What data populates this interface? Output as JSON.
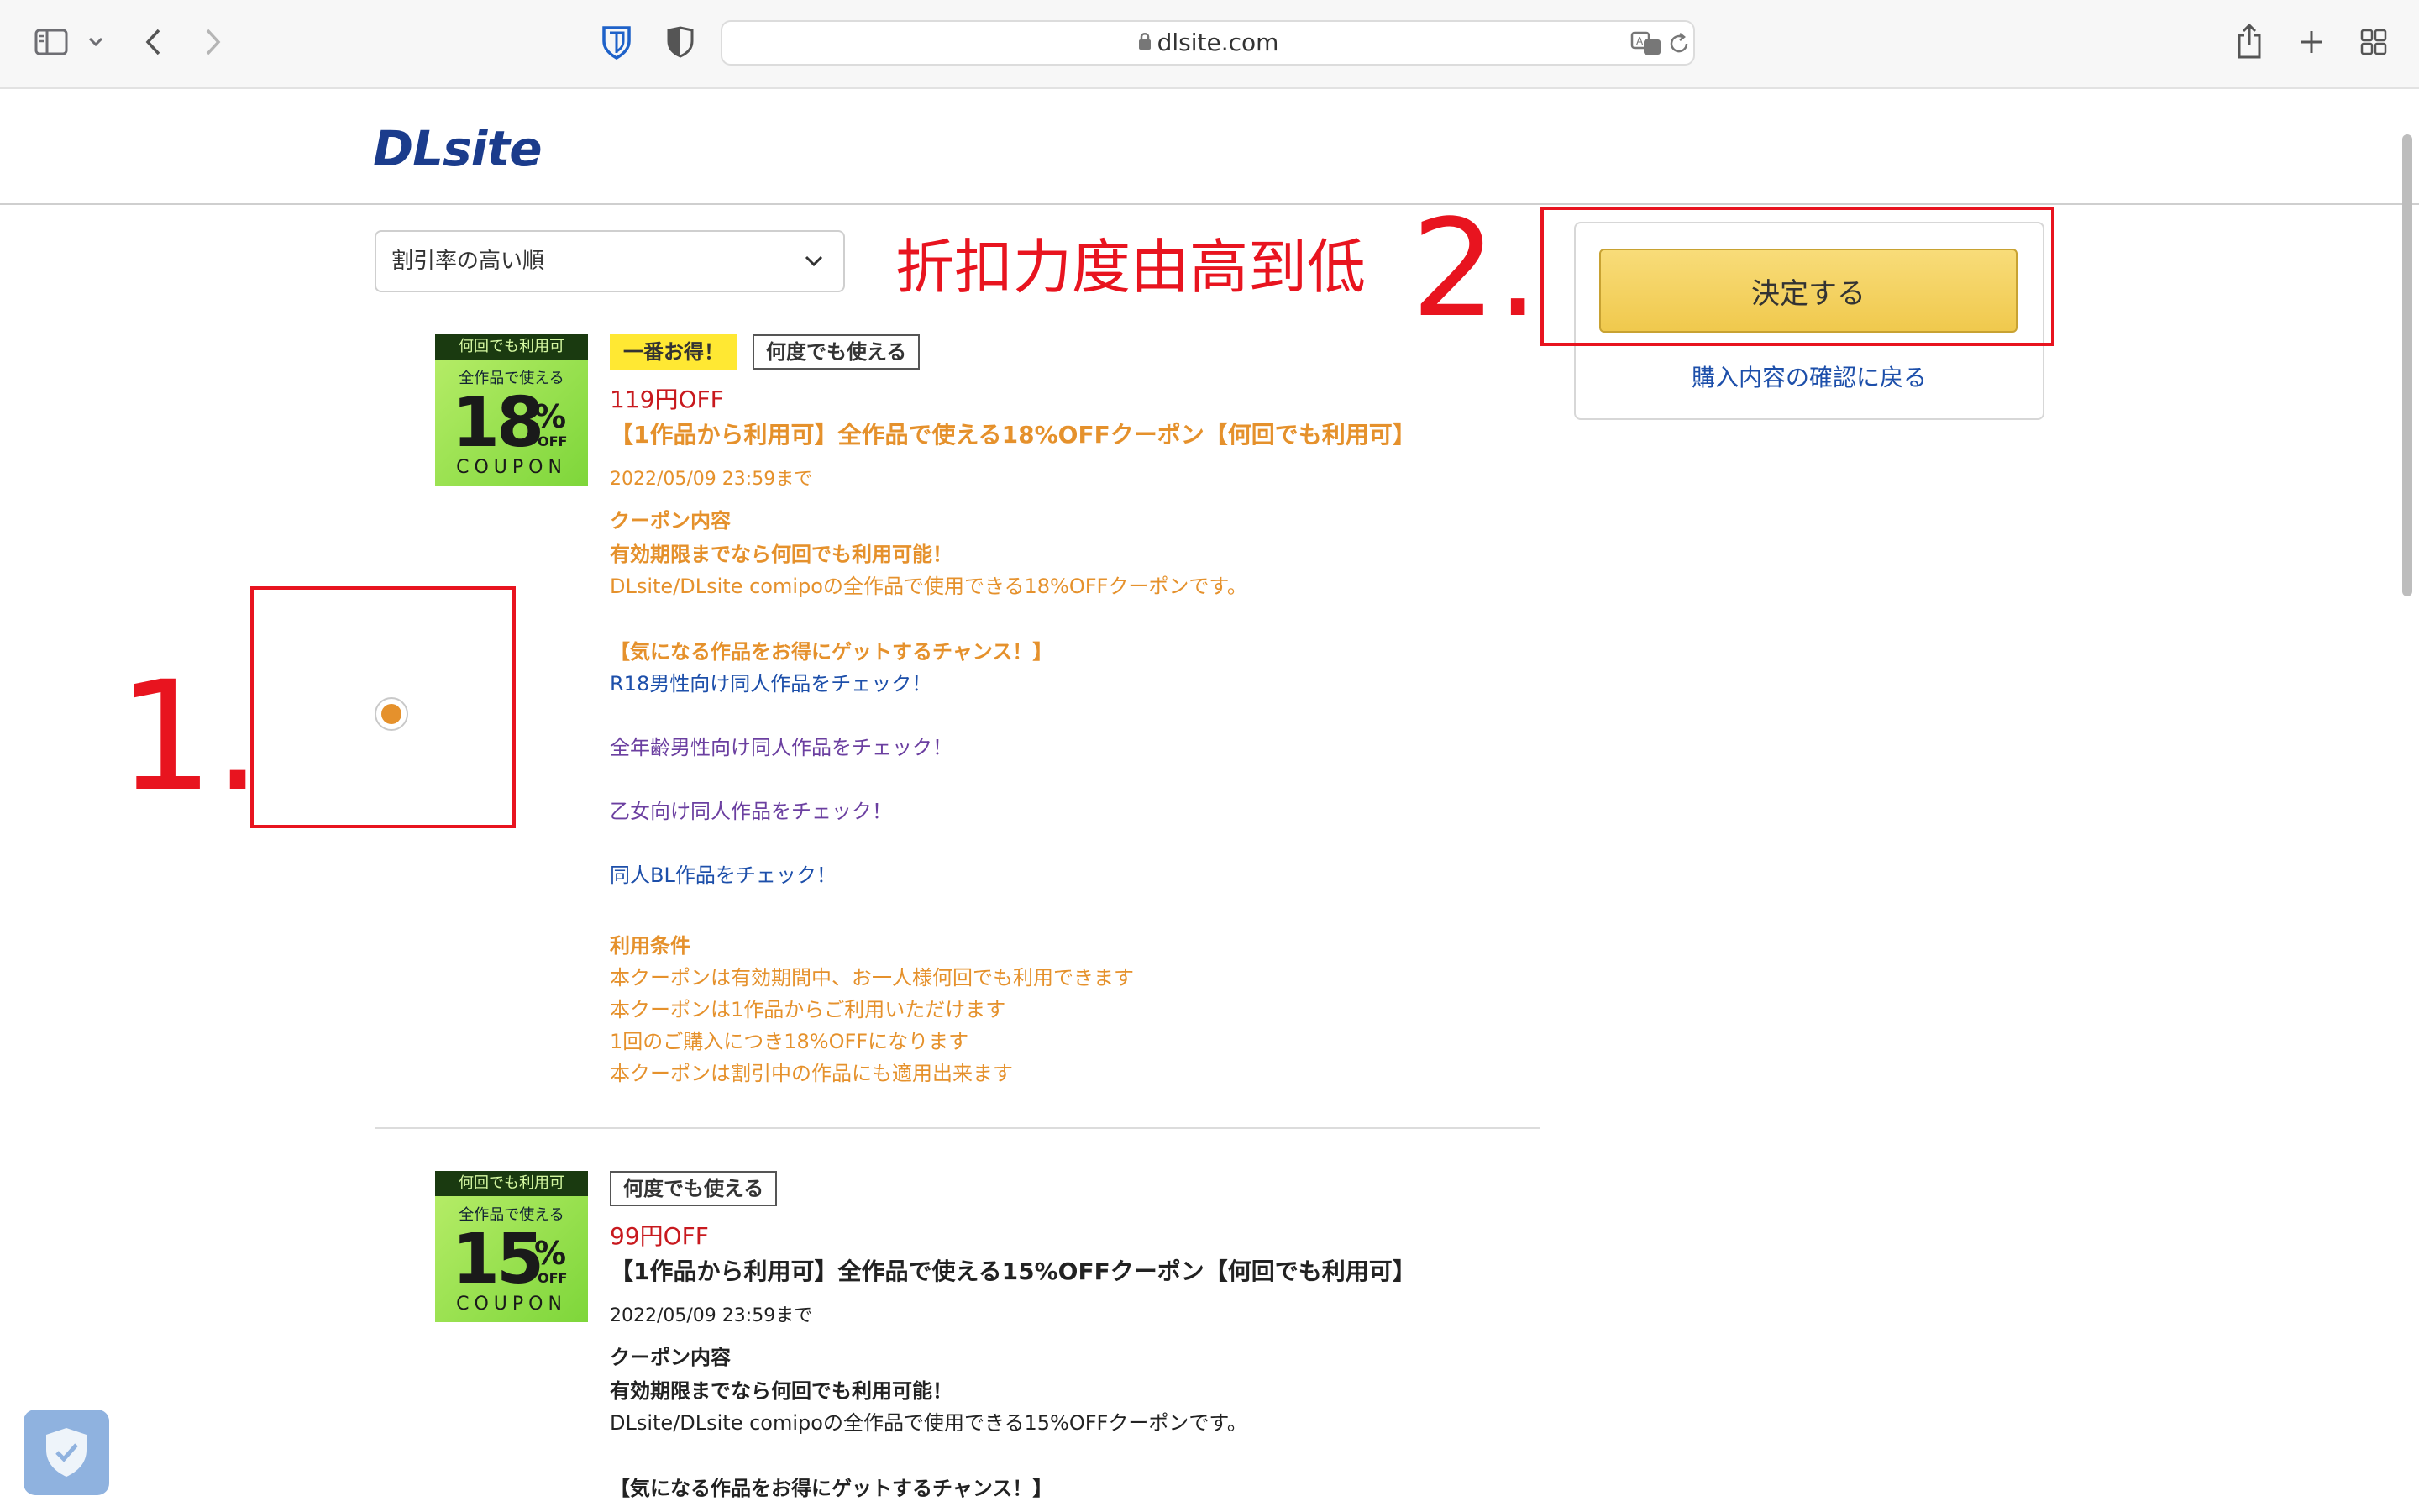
{
  "browser": {
    "url": "dlsite.com",
    "icons": [
      "sidebar-icon",
      "chevron-down-icon",
      "back-arrow-icon",
      "forward-arrow-icon",
      "bitwarden-shield-icon",
      "privacy-shield-icon",
      "lock-icon",
      "translate-icon",
      "reload-icon",
      "share-icon",
      "plus-icon",
      "tab-grid-icon"
    ]
  },
  "site": {
    "logo": "DLsite"
  },
  "sort": {
    "selected": "割引率の高い順"
  },
  "annotations": {
    "note": "折扣力度由高到低",
    "step1": "1.",
    "step2": "2."
  },
  "panel": {
    "confirm_label": "決定する",
    "back_label": "購入内容の確認に戻る"
  },
  "coupons": [
    {
      "image": {
        "top": "何回でも利用可",
        "sub": "全作品で使える",
        "pct": "18",
        "sign": "%",
        "off": "OFF",
        "coupon": "COUPON"
      },
      "badge_best": "一番お得！",
      "badge_reuse": "何度でも使える",
      "discount": "119円OFF",
      "title": "【1作品から利用可】全作品で使える18%OFFクーポン【何回でも利用可】",
      "deadline": "2022/05/09 23:59まで",
      "content_heading": "クーポン内容",
      "content_line1": "有効期限までなら何回でも利用可能！",
      "content_line2": "DLsite/DLsite comipoの全作品で使用できる18%OFFクーポンです。",
      "chance_heading": "【気になる作品をお得にゲットするチャンス！】",
      "link1": "R18男性向け同人作品をチェック！",
      "link2": "全年齢男性向け同人作品をチェック！",
      "link3": "乙女向け同人作品をチェック！",
      "link4": "同人BL作品をチェック！",
      "terms_heading": "利用条件",
      "terms": [
        "本クーポンは有効期間中、お一人様何回でも利用できます",
        "本クーポンは1作品からご利用いただけます",
        "1回のご購入につき18%OFFになります",
        "本クーポンは割引中の作品にも適用出来ます"
      ]
    },
    {
      "image": {
        "top": "何回でも利用可",
        "sub": "全作品で使える",
        "pct": "15",
        "sign": "%",
        "off": "OFF",
        "coupon": "COUPON"
      },
      "badge_reuse": "何度でも使える",
      "discount": "99円OFF",
      "title": "【1作品から利用可】全作品で使える15%OFFクーポン【何回でも利用可】",
      "deadline": "2022/05/09 23:59まで",
      "content_heading": "クーポン内容",
      "content_line1": "有効期限までなら何回でも利用可能！",
      "content_line2": "DLsite/DLsite comipoの全作品で使用できる15%OFFクーポンです。",
      "chance_heading": "【気になる作品をお得にゲットするチャンス！】"
    }
  ],
  "colors": {
    "accent_orange": "#e5912c",
    "annotation_red": "#e8141f",
    "link_blue": "#1d4faa",
    "discount_red": "#c8191e",
    "button_yellow": "#f0c94d"
  }
}
